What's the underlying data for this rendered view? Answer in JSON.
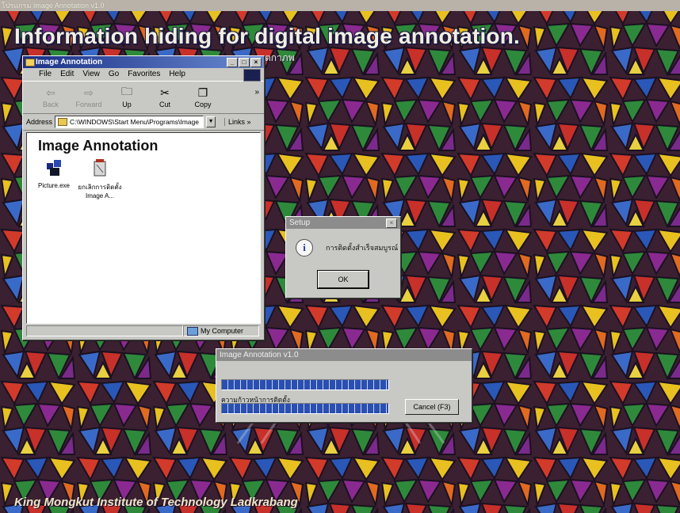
{
  "desktop": {
    "window_title": "โปรแกรม Image Annotation v1.0",
    "headline": "Information hiding for digital image annotation.",
    "subtitle_fragment": "ตกาภพ",
    "footer": "King Mongkut Institute of Technology Ladkrabang"
  },
  "explorer": {
    "title": "Image Annotation",
    "menu": [
      "File",
      "Edit",
      "View",
      "Go",
      "Favorites",
      "Help"
    ],
    "toolbar": {
      "back": "Back",
      "forward": "Forward",
      "up": "Up",
      "cut": "Cut",
      "copy": "Copy",
      "more": "»"
    },
    "address_label": "Address",
    "address_value": "C:\\WINDOWS\\Start Menu\\Programs\\Image",
    "links_label": "Links »",
    "folder_heading": "Image Annotation",
    "files": [
      {
        "name": "Picture.exe"
      },
      {
        "name": "ยกเลิกการติดตั้ง Image A..."
      }
    ],
    "status_computer": "My Computer"
  },
  "setup_dialog": {
    "title": "Setup",
    "close": "×",
    "message": "การติดตั้งสำเร็จสมบูรณ์",
    "ok_label": "OK"
  },
  "progress_dialog": {
    "title": "Image Annotation v1.0",
    "label": "ความก้าวหน้าการติดตั้ง",
    "cancel_label": "Cancel (F3)",
    "progress_top": 1.0,
    "progress_bottom": 1.0
  }
}
